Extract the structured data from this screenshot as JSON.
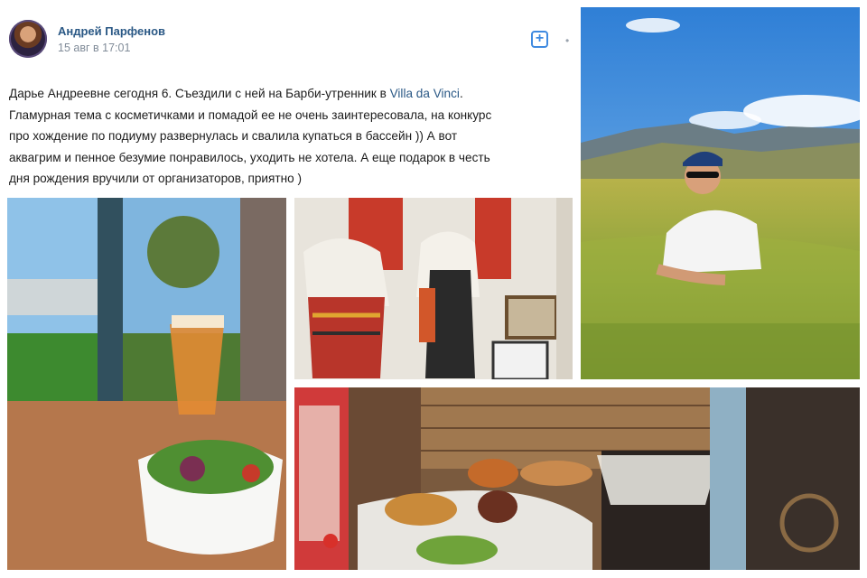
{
  "post": {
    "author": "Андрей Парфенов",
    "date": "15 авг в 17:01",
    "add_icon": "plus-square-icon",
    "more_icon": "dot-icon",
    "text_lines": [
      "Дарье Андреевне сегодня 6. Съездили с ней на Барби-утренник в ",
      "Гламурная тема с косметичками и помадой ее не очень заинтересовала, на конкурс",
      "про хождение по подиуму развернулась и свалила купаться в бассейн )) А вот",
      "аквагрим и пенное безумие понравилось, уходить не хотела. А еще подарок в честь",
      "дня рождения вручили от организаторов, приятно )"
    ],
    "link_text": "Villa da Vinci",
    "link_suffix": "."
  },
  "colors": {
    "link": "#2a5885",
    "meta": "#818c99",
    "accent": "#3f8ae0"
  }
}
